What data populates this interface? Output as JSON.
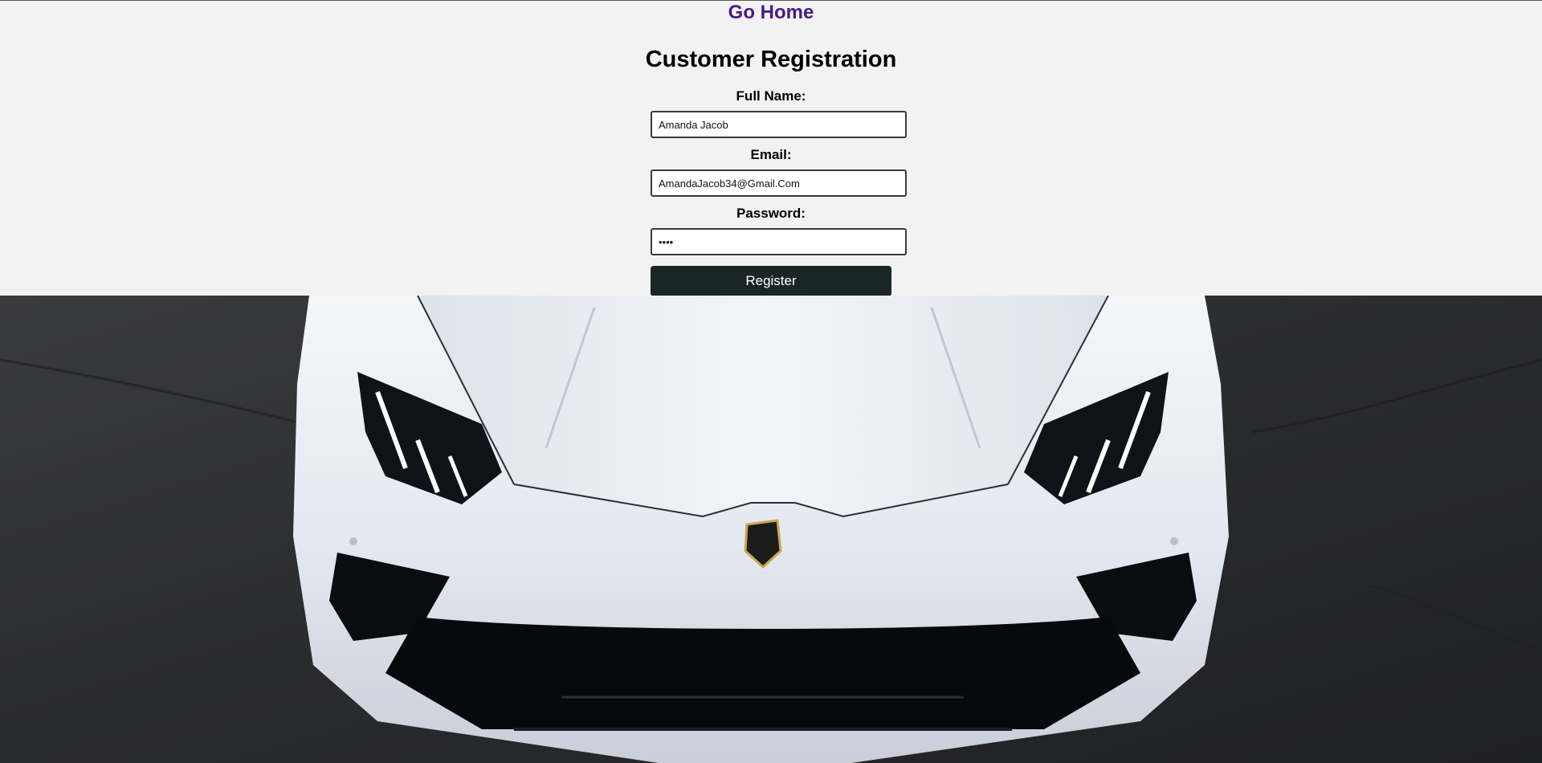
{
  "nav": {
    "go_home_label": "Go Home"
  },
  "form": {
    "title": "Customer Registration",
    "full_name": {
      "label": "Full Name:",
      "value": "Amanda Jacob"
    },
    "email": {
      "label": "Email:",
      "value": "AmandaJacob34@Gmail.Com"
    },
    "password": {
      "label": "Password:",
      "value": "abcd"
    },
    "register_label": "Register"
  },
  "colors": {
    "page_background": "#f2f2f2",
    "link": "#4b1b7f",
    "button_background": "#1a2526",
    "button_text": "#ffffff"
  },
  "hero_image": {
    "subject": "white-sports-car-front"
  }
}
